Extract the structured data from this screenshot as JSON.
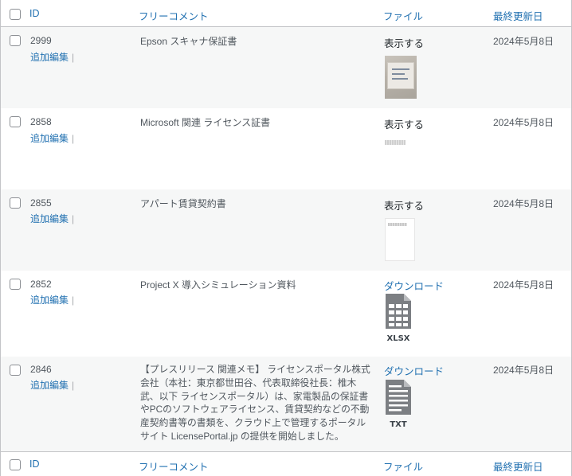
{
  "columns": {
    "id": "ID",
    "comment": "フリーコメント",
    "file": "ファイル",
    "date": "最終更新日"
  },
  "row_action": "追加編集",
  "row_action_sep": "|",
  "rows": [
    {
      "id": "2999",
      "comment": "Epson スキャナ保証書",
      "file_text": "表示する",
      "file_kind": "image-photo",
      "date": "2024年5月8日"
    },
    {
      "id": "2858",
      "comment": "Microsoft 関連 ライセンス証書",
      "file_text": "表示する",
      "file_kind": "image-small",
      "date": "2024年5月8日"
    },
    {
      "id": "2855",
      "comment": "アパート賃貸契約書",
      "file_text": "表示する",
      "file_kind": "image-document",
      "date": "2024年5月8日"
    },
    {
      "id": "2852",
      "comment": "Project X 導入シミュレーション資料",
      "file_text": "ダウンロード",
      "file_kind": "spreadsheet-icon",
      "file_type": "XLSX",
      "date": "2024年5月8日"
    },
    {
      "id": "2846",
      "comment": "【プレスリリース 関連メモ】 ライセンスポータル株式会社（本社：東京都世田谷、代表取締役社長：椎木武、以下 ライセンスポータル）は、家電製品の保証書やPCのソフトウェアライセンス、賃貸契約などの不動産契約書等の書類を、クラウド上で管理するポータルサイト LicensePortal.jp の提供を開始しました。",
      "file_text": "ダウンロード",
      "file_kind": "text-file-icon",
      "file_type": "TXT",
      "date": "2024年5月8日"
    }
  ]
}
